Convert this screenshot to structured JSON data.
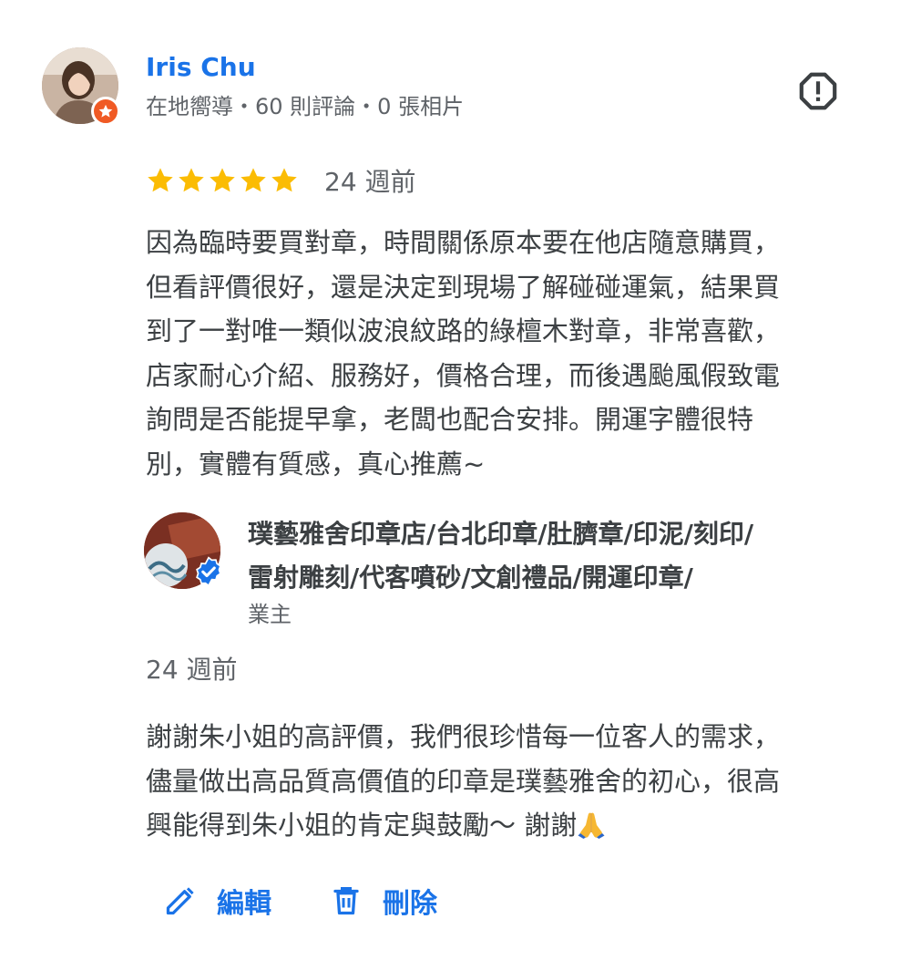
{
  "review": {
    "reviewer_name": "Iris Chu",
    "reviewer_meta": "在地嚮導・60 則評論・0 張相片",
    "rating": 5,
    "rating_max": 5,
    "date": "24 週前",
    "text_lines": [
      "因為臨時要買對章，時間關係原本要在他店隨意購買，",
      "但看評價很好，還是決定到現場了解碰碰運氣，結果買",
      "到了一對唯一類似波浪紋路的綠檀木對章，非常喜歡，",
      "店家耐心介紹、服務好，價格合理，而後遇颱風假致電",
      "詢問是否能提早拿，老闆也配合安排。開運字體很特",
      "別，實體有質感，真心推薦~"
    ]
  },
  "owner_reply": {
    "name_lines": [
      "璞藝雅舍印章店/台北印章/肚臍章/印泥/刻印/",
      "雷射雕刻/代客噴砂/文創禮品/開運印章/"
    ],
    "label": "業主",
    "date": "24 週前",
    "text_lines": [
      "謝謝朱小姐的高評價，我們很珍惜每一位客人的需求，",
      "儘量做出高品質高價值的印章是璞藝雅舍的初心，很高",
      "興能得到朱小姐的肯定與鼓勵～ 謝謝"
    ]
  },
  "actions": {
    "edit_label": "編輯",
    "delete_label": "刪除"
  },
  "icons": {
    "report": "report-flag-icon",
    "star": "star-icon",
    "local_guide": "local-guide-star-icon",
    "verified": "verified-check-icon",
    "edit": "pencil-icon",
    "delete": "trash-icon",
    "emoji": "folded-hands-emoji"
  },
  "colors": {
    "accent": "#1a73e8",
    "star": "#fbbc04",
    "text": "#3c4043",
    "secondary_text": "#5f6368",
    "local_guide_badge": "#f05a24"
  }
}
